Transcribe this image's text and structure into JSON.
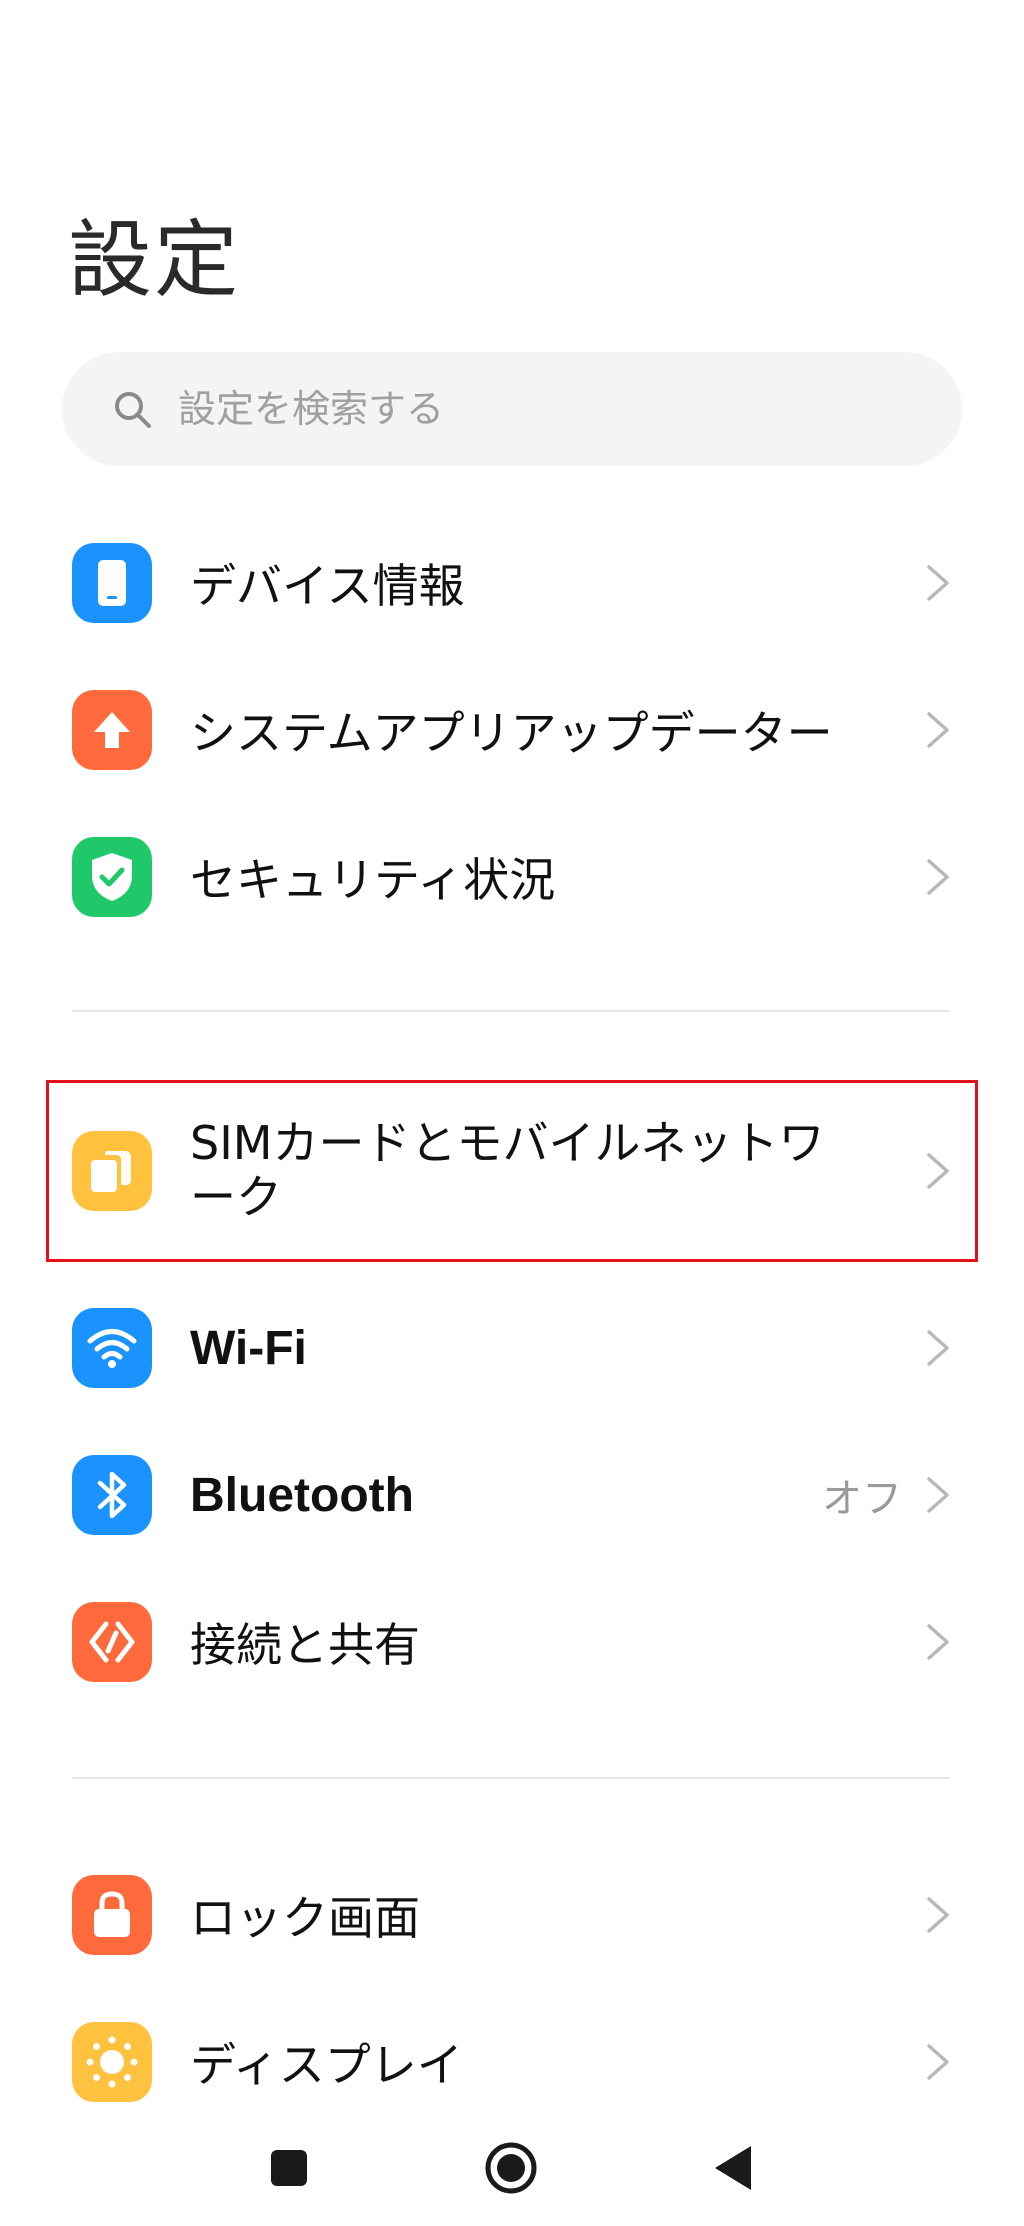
{
  "header": {
    "title": "設定"
  },
  "search": {
    "placeholder": "設定を検索する"
  },
  "sections": [
    {
      "items": [
        {
          "label": "デバイス情報",
          "icon": "phone-icon",
          "color": "#1a93ff"
        },
        {
          "label": "システムアプリアップデーター",
          "icon": "arrow-up-icon",
          "color": "#ff6a3d"
        },
        {
          "label": "セキュリティ状況",
          "icon": "shield-check-icon",
          "color": "#1fc96a"
        }
      ]
    },
    {
      "items": [
        {
          "label": "SIMカードとモバイルネットワーク",
          "icon": "sim-card-icon",
          "color": "#ffc23f",
          "highlighted": true
        },
        {
          "label": "Wi-Fi",
          "icon": "wifi-icon",
          "color": "#1a93ff"
        },
        {
          "label": "Bluetooth",
          "icon": "bluetooth-icon",
          "color": "#1a93ff",
          "value": "オフ"
        },
        {
          "label": "接続と共有",
          "icon": "connection-share-icon",
          "color": "#ff6a3d"
        }
      ]
    },
    {
      "items": [
        {
          "label": "ロック画面",
          "icon": "lock-icon",
          "color": "#ff6a3d"
        },
        {
          "label": "ディスプレイ",
          "icon": "sun-icon",
          "color": "#ffc23f"
        }
      ]
    }
  ],
  "nav": {
    "buttons": [
      "recents-icon",
      "home-icon",
      "back-icon"
    ]
  }
}
